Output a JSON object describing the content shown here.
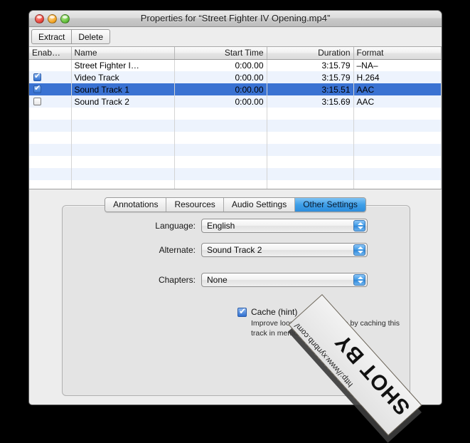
{
  "window": {
    "title": "Properties for “Street Fighter IV Opening.mp4”",
    "controls": {
      "close": "close",
      "minimize": "minimize",
      "zoom": "zoom"
    }
  },
  "toolbar": {
    "extract_label": "Extract",
    "delete_label": "Delete"
  },
  "table": {
    "columns": [
      "Enab…",
      "Name",
      "Start Time",
      "Duration",
      "Format"
    ],
    "rows": [
      {
        "enabled": null,
        "name": "Street Fighter I…",
        "start": "0:00.00",
        "duration": "3:15.79",
        "format": "–NA–",
        "selected": false
      },
      {
        "enabled": true,
        "name": "Video Track",
        "start": "0:00.00",
        "duration": "3:15.79",
        "format": "H.264",
        "selected": false
      },
      {
        "enabled": true,
        "name": "Sound Track 1",
        "start": "0:00.00",
        "duration": "3:15.51",
        "format": "AAC",
        "selected": true
      },
      {
        "enabled": false,
        "name": "Sound Track 2",
        "start": "0:00.00",
        "duration": "3:15.69",
        "format": "AAC",
        "selected": false
      }
    ]
  },
  "tabs": [
    {
      "label": "Annotations",
      "active": false
    },
    {
      "label": "Resources",
      "active": false
    },
    {
      "label": "Audio Settings",
      "active": false
    },
    {
      "label": "Other Settings",
      "active": true
    }
  ],
  "other_settings": {
    "language_label": "Language:",
    "language_value": "English",
    "alternate_label": "Alternate:",
    "alternate_value": "Sound Track 2",
    "chapters_label": "Chapters:",
    "chapters_value": "None",
    "cache_label": "Cache (hint)",
    "cache_checked": true,
    "cache_hint": "Improve looping performance by caching this track in memory."
  },
  "watermark": {
    "big": "SHOT BY",
    "url": "http://www.xynbnb.com/"
  },
  "colors": {
    "selection": "#3a72d2",
    "alt_row": "#edf3fd",
    "active_tab": "#3e9fe8"
  }
}
